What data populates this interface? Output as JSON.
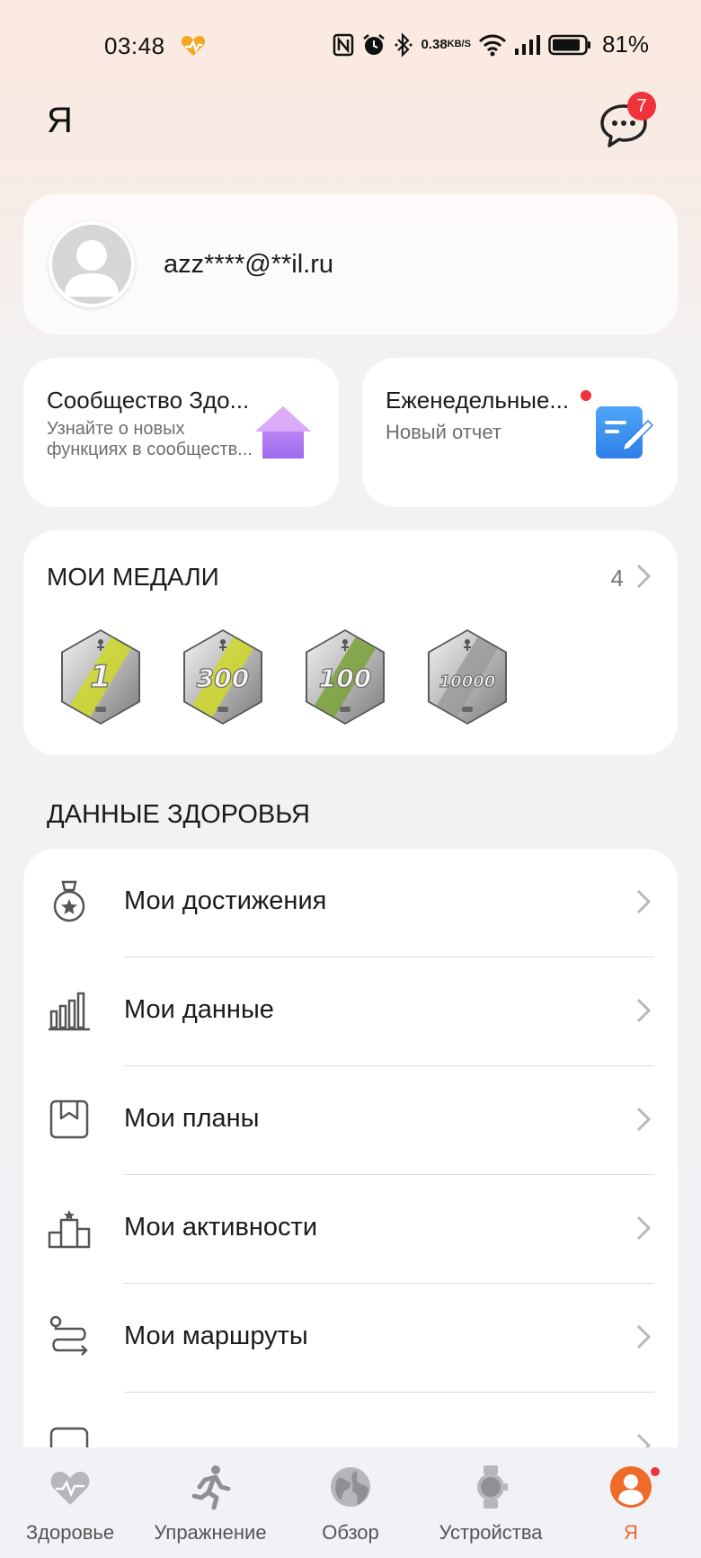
{
  "status_bar": {
    "time": "03:48",
    "speed_value": "0.38",
    "speed_unit": "KB/S",
    "battery_percent": "81%"
  },
  "header": {
    "title": "Я",
    "messages_badge": "7"
  },
  "profile": {
    "email": "azz****@**il.ru"
  },
  "community_card": {
    "title": "Сообщество Здо...",
    "subtitle": "Узнайте о новых функциях в сообществ...",
    "icon": "house-icon"
  },
  "weekly_card": {
    "title": "Еженедельные...",
    "subtitle": "Новый отчет",
    "icon": "note-edit-icon"
  },
  "medals": {
    "title": "МОИ МЕДАЛИ",
    "count": "4",
    "items": [
      {
        "label": "1",
        "stripe": "#cfd92a"
      },
      {
        "label": "300",
        "stripe": "#cfd92a"
      },
      {
        "label": "100",
        "stripe": "#7aa23a"
      },
      {
        "label": "10000",
        "stripe": "#9b9b9b"
      }
    ]
  },
  "health_data": {
    "title": "ДАННЫЕ ЗДОРОВЬЯ",
    "items": [
      {
        "label": "Мои достижения",
        "icon": "medal-icon"
      },
      {
        "label": "Мои данные",
        "icon": "bar-chart-icon"
      },
      {
        "label": "Мои планы",
        "icon": "plan-icon"
      },
      {
        "label": "Мои активности",
        "icon": "podium-icon"
      },
      {
        "label": "Мои маршруты",
        "icon": "route-icon"
      }
    ]
  },
  "bottom_nav": {
    "items": [
      {
        "label": "Здоровье",
        "icon": "heart-icon"
      },
      {
        "label": "Упражнение",
        "icon": "runner-icon"
      },
      {
        "label": "Обзор",
        "icon": "globe-icon"
      },
      {
        "label": "Устройства",
        "icon": "watch-icon"
      },
      {
        "label": "Я",
        "icon": "profile-icon"
      }
    ],
    "active_index": 4,
    "accent": "#f06a2a"
  }
}
